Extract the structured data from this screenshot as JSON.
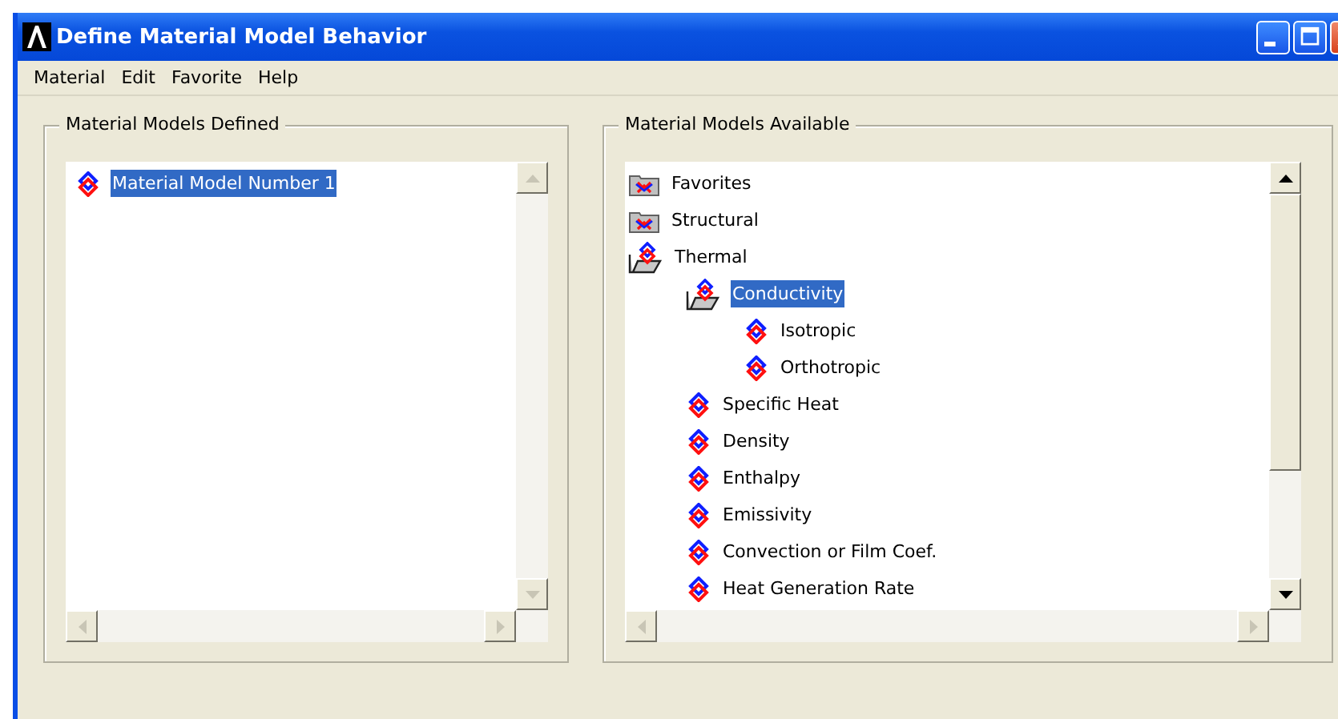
{
  "window": {
    "title": "Define Material Model Behavior"
  },
  "menu": [
    "Material",
    "Edit",
    "Favorite",
    "Help"
  ],
  "defined": {
    "title": "Material Models Defined",
    "items": [
      {
        "kind": "model",
        "label": "Material Model Number 1",
        "selected": true
      }
    ]
  },
  "available": {
    "title": "Material Models Available",
    "items": [
      {
        "kind": "folder",
        "label": "Favorites",
        "selected": false,
        "expanded": false
      },
      {
        "kind": "folder",
        "label": "Structural",
        "selected": false,
        "expanded": false
      },
      {
        "kind": "folder",
        "label": "Thermal",
        "selected": false,
        "expanded": true,
        "children": [
          {
            "kind": "folder",
            "label": "Conductivity",
            "selected": true,
            "expanded": true,
            "children": [
              {
                "kind": "model",
                "label": "Isotropic",
                "selected": false
              },
              {
                "kind": "model",
                "label": "Orthotropic",
                "selected": false
              }
            ]
          },
          {
            "kind": "model",
            "label": "Specific Heat",
            "selected": false
          },
          {
            "kind": "model",
            "label": "Density",
            "selected": false
          },
          {
            "kind": "model",
            "label": "Enthalpy",
            "selected": false
          },
          {
            "kind": "model",
            "label": "Emissivity",
            "selected": false
          },
          {
            "kind": "model",
            "label": "Convection or Film Coef.",
            "selected": false
          },
          {
            "kind": "model",
            "label": "Heat Generation Rate",
            "selected": false
          }
        ]
      }
    ]
  }
}
